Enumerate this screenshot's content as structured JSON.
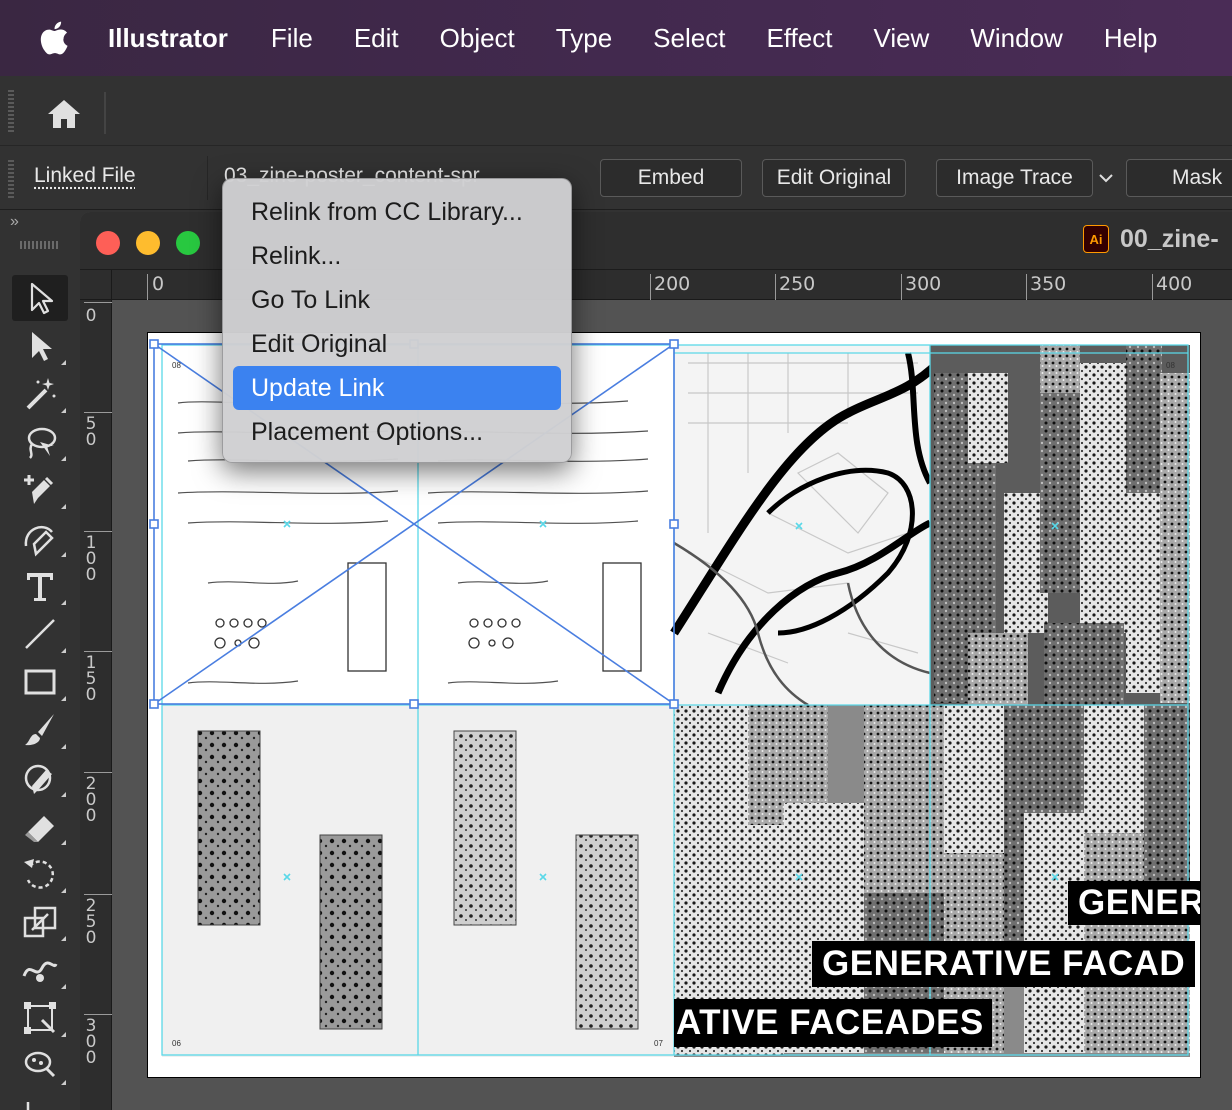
{
  "menubar": {
    "apple_icon": "apple-logo",
    "app_name": "Illustrator",
    "items": [
      "File",
      "Edit",
      "Object",
      "Type",
      "Select",
      "Effect",
      "View",
      "Window",
      "Help"
    ]
  },
  "appbar": {
    "home_icon": "home-icon"
  },
  "controlbar": {
    "linked_file_label": "Linked File",
    "filename": "03_zine-poster_content-spr",
    "embed_label": "Embed",
    "edit_original_label": "Edit Original",
    "image_trace_label": "Image Trace",
    "mask_label": "Mask"
  },
  "tools": {
    "expand_chevron": "»",
    "items": [
      "selection-tool",
      "direct-selection-tool",
      "magic-wand-tool",
      "lasso-tool",
      "add-anchor-point-tool",
      "pen-tool",
      "type-tool",
      "line-segment-tool",
      "rectangle-tool",
      "paintbrush-tool",
      "shaper-tool",
      "eraser-tool",
      "rotate-tool",
      "scale-tool",
      "warp-tool",
      "free-transform-tool",
      "symbol-sprayer-tool",
      "graph-tool"
    ]
  },
  "document": {
    "title": "00_zine-",
    "ai_badge": "Ai",
    "ruler_h": [
      "0",
      "200",
      "250",
      "300",
      "350",
      "400"
    ],
    "ruler_v": [
      "0",
      "50",
      "100",
      "150",
      "200",
      "250",
      "300"
    ]
  },
  "context_menu": {
    "items": [
      "Relink from CC Library...",
      "Relink...",
      "Go To Link",
      "Edit Original",
      "Update Link",
      "Placement Options..."
    ],
    "selected_index": 4
  },
  "artboard": {
    "page_numbers": [
      "08",
      "08",
      "06",
      "07"
    ],
    "poster_text": {
      "line1": "GENER",
      "line2": "GENERATIVE  FACAD",
      "line3": "ATIVE FACEADES"
    }
  },
  "colors": {
    "menubar": "#42294e",
    "panel": "#323232",
    "selection_accent": "#3b82f0",
    "guide_cyan": "#5ad8e8",
    "link_box_blue": "#4a7ee0"
  }
}
